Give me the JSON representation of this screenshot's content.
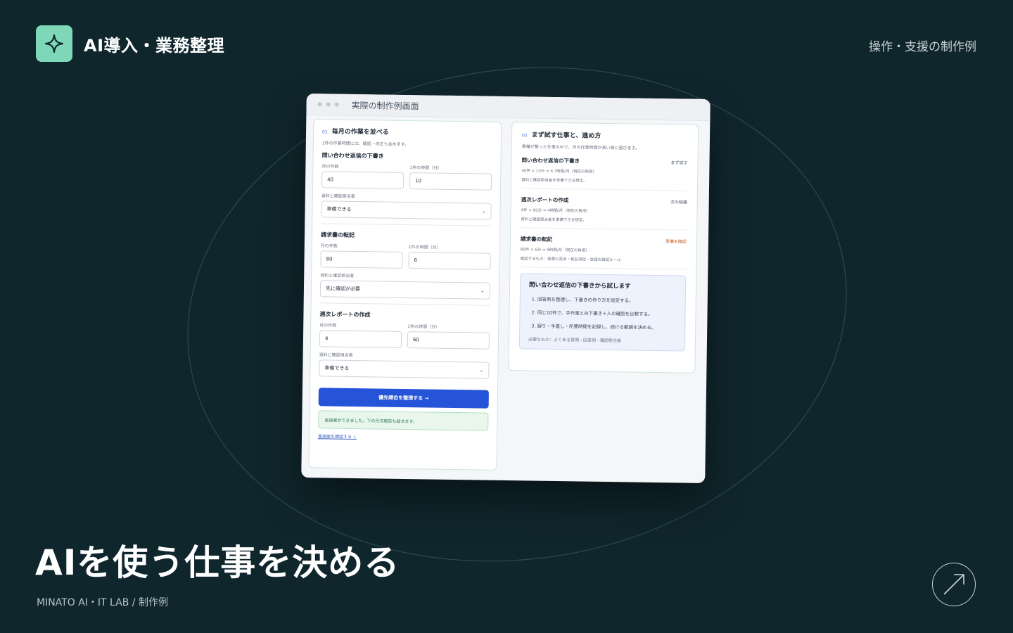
{
  "brand": {
    "name": "AI導入・業務整理",
    "logo_icon": "sparkle-icon",
    "accent": "#7ed8b8"
  },
  "header": {
    "right_label": "操作・支援の制作例"
  },
  "page": {
    "title": "AIを使う仕事を決める",
    "credit": "MINATO AI・IT LAB / 制作例",
    "background": "#10262d"
  },
  "mockup": {
    "window_title": "実際の制作例画面",
    "left": {
      "number": "01",
      "title": "毎月の作業を並べる",
      "subtitle": "1件の作業時間には、確認・修正も含めます。",
      "labels": {
        "count": "月の件数",
        "minutes": "1件の時間（分）",
        "owner": "資料と確認担当者"
      },
      "tasks": [
        {
          "name": "問い合わせ返信の下書き",
          "count": "40",
          "minutes": "10",
          "owner": "準備できる"
        },
        {
          "name": "請求書の転記",
          "count": "80",
          "minutes": "6",
          "owner": "先に確認が必要"
        },
        {
          "name": "週次レポートの作成",
          "count": "4",
          "minutes": "60",
          "owner": "準備できる"
        }
      ],
      "cta": "優先順位を整理する →",
      "notice": "実施案ができました。下の月次報告も話せます。",
      "link": "実施案を確認する ↓"
    },
    "right": {
      "number": "02",
      "title": "まず試す仕事と、進め方",
      "subtitle": "準備が整った仕事の中で、月の作業時間が長い順に選びます。",
      "items": [
        {
          "title": "問い合わせ返信の下書き",
          "status": "まず試す",
          "line1": "40件 × 10分 = 6.7時間/月（現在の負担）",
          "line2": "資料と確認担当者を準備できる想定。"
        },
        {
          "title": "週次レポートの作成",
          "status": "次の候補",
          "line1": "4件 × 60分 = 4時間/月（現在の負担）",
          "line2": "資料と確認担当者を準備できる想定。"
        },
        {
          "title": "請求書の転記",
          "status": "準備を確認",
          "line1": "80件 × 6分 = 8時間/月（現在の負担）",
          "line2": "確認するもの：帳票の見本・転記項目・金額の確認ルール"
        }
      ],
      "plan": {
        "title": "問い合わせ返信の下書きから試します",
        "steps": [
          "1. 回答例を整理し、下書きの作り方を設定する。",
          "2. 同じ10件で、手作業とAI下書き＋人の確認を比較する。",
          "3. 誤り・手直し・所要時間を記録し、続ける範囲を決める。"
        ],
        "requirements": "必要なもの：よくある質問・回答例・確認担当者"
      }
    }
  }
}
